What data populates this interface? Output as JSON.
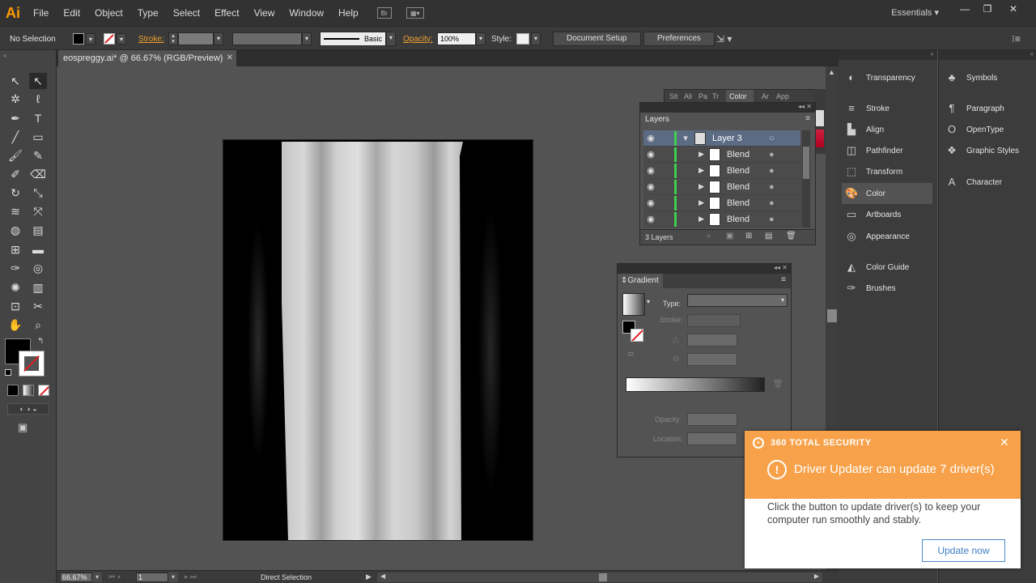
{
  "menubar": {
    "logo": "Ai",
    "items": [
      "File",
      "Edit",
      "Object",
      "Type",
      "Select",
      "Effect",
      "View",
      "Window",
      "Help"
    ],
    "workspace": "Essentials",
    "bridge_icon": "Br",
    "win_min": "—",
    "win_max": "❐",
    "win_close": "✕"
  },
  "control": {
    "selection": "No Selection",
    "stroke_label": "Stroke:",
    "brush_label": "Basic",
    "opacity_label": "Opacity:",
    "opacity_value": "100%",
    "style_label": "Style:",
    "document_setup": "Document Setup",
    "preferences": "Preferences"
  },
  "document": {
    "tab_title": "eospreggy.ai* @ 66.67% (RGB/Preview)",
    "tab_close": "✕"
  },
  "layers_panel": {
    "tabs": [
      "Sti",
      "Ali",
      "Pa",
      "Tr",
      "Color",
      "Ar",
      "App"
    ],
    "title": "Layers",
    "layer_name": "Layer 3",
    "rows": [
      "Blend",
      "Blend",
      "Blend",
      "Blend",
      "Blend"
    ],
    "footer": "3 Layers"
  },
  "gradient_panel": {
    "title": "Gradient",
    "type_label": "Type:",
    "stroke_label": "Stroke:",
    "opacity_label": "Opacity:",
    "location_label": "Location:"
  },
  "dock_col1": [
    "Transparency",
    "Stroke",
    "Align",
    "Pathfinder",
    "Transform",
    "Color",
    "Artboards",
    "Appearance",
    "Color Guide",
    "Brushes"
  ],
  "dock_col2": [
    "Symbols",
    "Paragraph",
    "OpenType",
    "Graphic Styles",
    "Character"
  ],
  "status": {
    "zoom": "66.67%",
    "artboard": "1",
    "tool": "Direct Selection"
  },
  "notification": {
    "brand": "360 TOTAL SECURITY",
    "headline": "Driver Updater can update 7 driver(s)",
    "body_line1": "Click the button to update driver(s) to keep your",
    "body_line2": "computer run smoothly and stably.",
    "button": "Update now",
    "close": "✕"
  },
  "colors": {
    "accent": "#f7a24a",
    "panel_bg": "#535353",
    "chrome": "#323232",
    "layer_green": "#3fcf4f",
    "selected_row": "#5b6b84"
  }
}
